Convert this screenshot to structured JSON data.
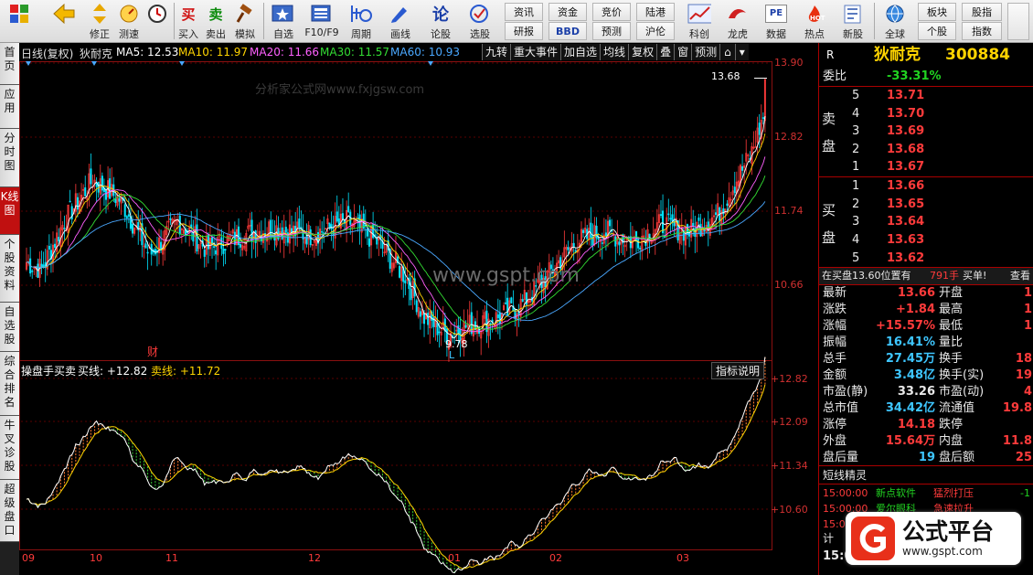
{
  "toolbar": {
    "buttons": [
      {
        "label": "",
        "icon": "grid-icon"
      },
      {
        "label": "",
        "icon": "back-arrow-icon"
      },
      {
        "label": "修正",
        "icon": "updown-arrow-icon"
      },
      {
        "label": "测速",
        "icon": "speed-icon"
      },
      {
        "label": "",
        "icon": "clock-icon"
      },
      {
        "label": "买入",
        "icon_text": "买"
      },
      {
        "label": "卖出",
        "icon_text": "卖"
      },
      {
        "label": "模拟",
        "icon": "gavel-icon"
      },
      {
        "label": "自选",
        "icon": "star-icon"
      },
      {
        "label": "F10/F9",
        "icon": "document-icon"
      },
      {
        "label": "周期",
        "icon": "period-icon"
      },
      {
        "label": "画线",
        "icon": "pencil-icon"
      },
      {
        "label": "论股",
        "icon_text": "论"
      },
      {
        "label": "选股",
        "icon": "select-icon"
      },
      {
        "label": "科创",
        "icon": "chart-icon"
      },
      {
        "label": "龙虎",
        "icon": "dragon-icon"
      },
      {
        "label": "数据",
        "icon_text": "PE"
      },
      {
        "label": "热点",
        "icon": "hot-icon"
      },
      {
        "label": "新股",
        "icon": "new-stock-icon"
      },
      {
        "label": "全球",
        "icon": "globe-icon"
      }
    ],
    "small": [
      "资讯",
      "资金",
      "竞价",
      "陆港",
      "研报",
      "BBD",
      "预测",
      "沪伦",
      "板块",
      "股指",
      "个股",
      "指数"
    ]
  },
  "left_tabs": [
    "首页",
    "应用",
    "分时图",
    "K线图",
    "个股资料",
    "自选股",
    "综合排名",
    "牛叉诊股",
    "超级盘口"
  ],
  "chart": {
    "header": {
      "period": "日线(复权)",
      "name": "狄耐克",
      "ma5": "MA5: 12.53",
      "ma10": "MA10: 11.97",
      "ma20": "MA20: 11.66",
      "ma30": "MA30: 11.57",
      "ma60": "MA60: 10.93"
    },
    "buttons": [
      "九转",
      "重大事件",
      "加自选",
      "均线",
      "复权",
      "叠",
      "窗",
      "预测"
    ],
    "watermark": "分析家公式网www.fxjgsw.com",
    "center_watermark": "www.gspt.com",
    "price_ticks": [
      "13.90",
      "12.82",
      "11.74",
      "10.66"
    ],
    "high_label": "13.68",
    "low_label": "9.78",
    "cai_label": "财",
    "l_label": "L",
    "sub": {
      "title": "操盘手买卖",
      "buy": "买线: +12.82",
      "sell": "卖线: +11.72",
      "button": "指标说明",
      "ticks": [
        "+12.82",
        "+12.09",
        "+11.34",
        "+10.60"
      ]
    },
    "x_labels": [
      "09",
      "10",
      "11",
      "12",
      "01",
      "02",
      "03"
    ],
    "colors": {
      "up": "#ff3b3b",
      "down": "#00e5ff",
      "ma5": "#ffffff",
      "ma10": "#ffd400",
      "ma20": "#ff60ff",
      "ma30": "#33dd33",
      "ma60": "#4aa8ff"
    }
  },
  "chart_data": {
    "type": "line",
    "title": "",
    "x": [
      "09",
      "10",
      "11",
      "12",
      "01",
      "02",
      "03"
    ],
    "ylim": [
      9.6,
      13.9
    ],
    "series": [
      {
        "name": "MA5",
        "values": [
          11.2,
          11.6,
          11.0,
          11.8,
          10.0,
          11.3,
          12.53
        ]
      },
      {
        "name": "MA10",
        "values": [
          11.1,
          11.7,
          11.2,
          11.7,
          10.1,
          11.2,
          11.97
        ]
      },
      {
        "name": "MA20",
        "values": [
          11.0,
          11.5,
          11.4,
          11.6,
          10.4,
          11.0,
          11.66
        ]
      },
      {
        "name": "MA30",
        "values": [
          10.9,
          11.3,
          11.4,
          11.5,
          10.7,
          10.9,
          11.57
        ]
      },
      {
        "name": "MA60",
        "values": [
          10.8,
          11.0,
          11.2,
          11.3,
          11.0,
          10.8,
          10.93
        ]
      }
    ]
  },
  "panel": {
    "stock_name": "狄耐克",
    "stock_code": "300884",
    "r_label": "R",
    "webi_label": "委比",
    "webi_value": "-33.31%",
    "sell_label": [
      "卖",
      "盘"
    ],
    "buy_label": [
      "买",
      "盘"
    ],
    "asks": [
      {
        "lvl": "5",
        "price": "13.71"
      },
      {
        "lvl": "4",
        "price": "13.70"
      },
      {
        "lvl": "3",
        "price": "13.69"
      },
      {
        "lvl": "2",
        "price": "13.68"
      },
      {
        "lvl": "1",
        "price": "13.67"
      }
    ],
    "bids": [
      {
        "lvl": "1",
        "price": "13.66"
      },
      {
        "lvl": "2",
        "price": "13.65"
      },
      {
        "lvl": "3",
        "price": "13.64"
      },
      {
        "lvl": "4",
        "price": "13.63"
      },
      {
        "lvl": "5",
        "price": "13.62"
      }
    ],
    "order_line": {
      "text": "在买盘13.60位置有",
      "qty": "791手",
      "tag": "买单!",
      "more": "查看"
    },
    "quotes": [
      {
        "l": "最新",
        "v": "13.66",
        "vc": "red",
        "l2": "开盘",
        "v2": "1"
      },
      {
        "l": "涨跌",
        "v": "+1.84",
        "vc": "red",
        "l2": "最高",
        "v2": "1"
      },
      {
        "l": "涨幅",
        "v": "+15.57%",
        "vc": "red",
        "l2": "最低",
        "v2": "1"
      },
      {
        "l": "振幅",
        "v": "16.41%",
        "vc": "cyan",
        "l2": "量比",
        "v2": ""
      },
      {
        "l": "总手",
        "v": "27.45万",
        "vc": "cyan",
        "l2": "换手",
        "v2": "18"
      },
      {
        "l": "金额",
        "v": "3.48亿",
        "vc": "cyan",
        "l2": "换手(实)",
        "v2": "19"
      },
      {
        "l": "市盈(静)",
        "v": "33.26",
        "vc": "white",
        "l2": "市盈(动)",
        "v2": "4"
      },
      {
        "l": "总市值",
        "v": "34.42亿",
        "vc": "cyan",
        "l2": "流通值",
        "v2": "19.8"
      },
      {
        "l": "涨停",
        "v": "14.18",
        "vc": "red",
        "l2": "跌停",
        "v2": ""
      },
      {
        "l": "外盘",
        "v": "15.64万",
        "vc": "red",
        "l2": "内盘",
        "v2": "11.8"
      },
      {
        "l": "盘后量",
        "v": "19",
        "vc": "cyan",
        "l2": "盘后额",
        "v2": "25"
      }
    ],
    "short_title": "短线精灵",
    "short_rows": [
      {
        "t": "15:00:00",
        "n": "新点软件",
        "e": "猛烈打压",
        "v": "-1"
      },
      {
        "t": "15:00:00",
        "n": "爱尔眼科",
        "e": "急速拉升",
        "v": ""
      },
      {
        "t": "15:00:00",
        "n": "",
        "e": "",
        "v": ""
      }
    ],
    "calc_label": "计",
    "time_label": "15:0"
  },
  "brand": {
    "text": "公式平台",
    "url": "www.gspt.com"
  }
}
